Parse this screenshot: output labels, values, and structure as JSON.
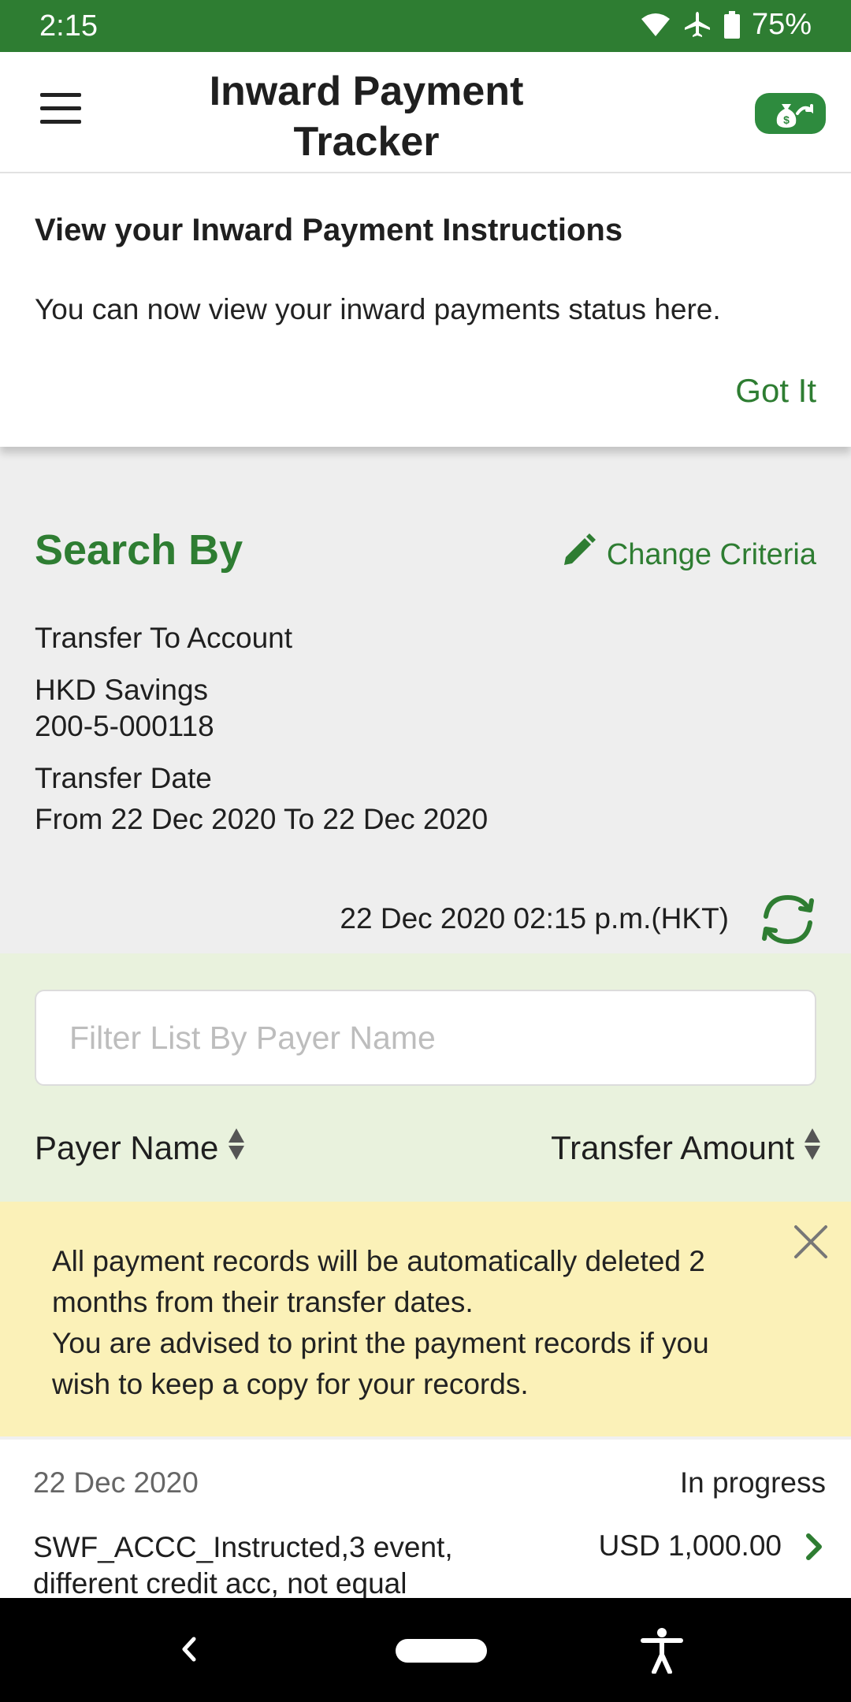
{
  "status_bar": {
    "time": "2:15",
    "battery": "75%"
  },
  "app_bar": {
    "title": "Inward Payment Tracker"
  },
  "notice": {
    "heading": "View your Inward Payment Instructions",
    "body": "You can now view your inward payments status here.",
    "action": "Got It"
  },
  "search": {
    "heading": "Search By",
    "change_label": "Change Criteria",
    "account_label": "Transfer To Account",
    "account_name": "HKD Savings",
    "account_number": "200-5-000118",
    "date_label": "Transfer Date",
    "date_range": "From 22 Dec 2020 To 22 Dec 2020",
    "timestamp": "22 Dec 2020 02:15 p.m.(HKT)"
  },
  "list": {
    "filter_placeholder": "Filter List By Payer Name",
    "col_payer": "Payer Name",
    "col_amount": "Transfer Amount"
  },
  "warning": {
    "line1": "All payment records will be automatically deleted 2 months from their transfer dates.",
    "line2": "You are advised to print the payment records if you wish to keep a copy for your records."
  },
  "records": [
    {
      "date": "22 Dec 2020",
      "status": "In progress",
      "payer": "SWF_ACCC_Instructed,3 event, different credit acc, not equal",
      "amount": "USD 1,000.00"
    }
  ],
  "colors": {
    "brand_green": "#2e7d32",
    "warning_bg": "#fbf1b8",
    "list_bg": "#e9f2dd"
  }
}
